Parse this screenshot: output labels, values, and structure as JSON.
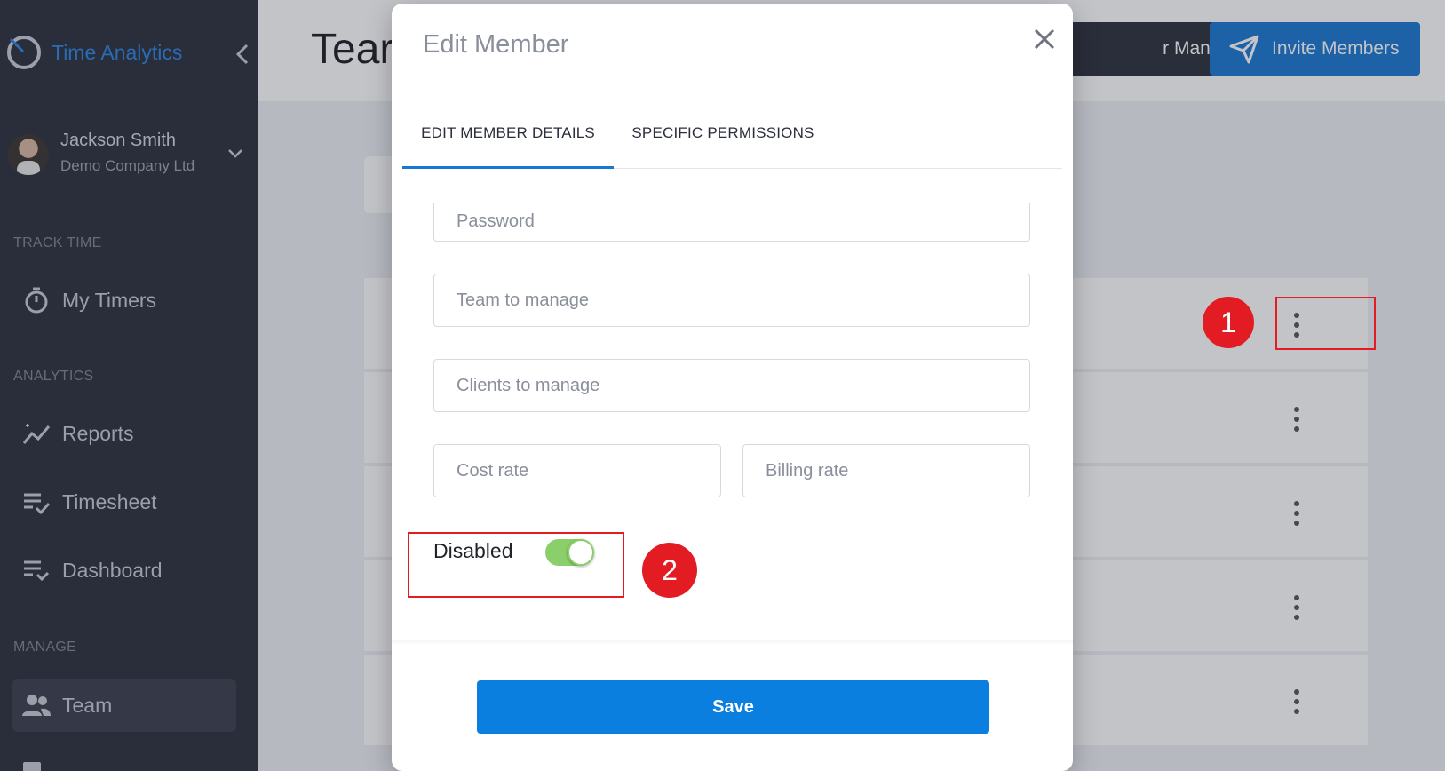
{
  "sidebar": {
    "brand": "Time Analytics",
    "user": {
      "name": "Jackson Smith",
      "company": "Demo Company Ltd"
    },
    "sections": {
      "track_time": "TRACK TIME",
      "analytics": "ANALYTICS",
      "manage": "MANAGE"
    },
    "items": {
      "my_timers": "My Timers",
      "reports": "Reports",
      "timesheet": "Timesheet",
      "dashboard": "Dashboard",
      "team": "Team"
    }
  },
  "header": {
    "title": "Tear",
    "add_manual_label": "r Manually",
    "invite_label": "Invite Members"
  },
  "annotations": {
    "badge_1": "1",
    "badge_2": "2",
    "color": "#e31b23"
  },
  "modal": {
    "title": "Edit Member",
    "tabs": [
      "EDIT MEMBER DETAILS",
      "SPECIFIC PERMISSIONS"
    ],
    "active_tab": "EDIT MEMBER DETAILS",
    "fields": {
      "password": "Password",
      "team_to_manage": "Team to manage",
      "clients_to_manage": "Clients to manage",
      "cost_rate": "Cost rate",
      "billing_rate": "Billing rate"
    },
    "toggle": {
      "label": "Disabled",
      "on": true
    },
    "save_label": "Save"
  },
  "colors": {
    "accent": "#1976d2",
    "sidebar": "#2b2e3b",
    "toggle_on": "#8bcf6a"
  }
}
